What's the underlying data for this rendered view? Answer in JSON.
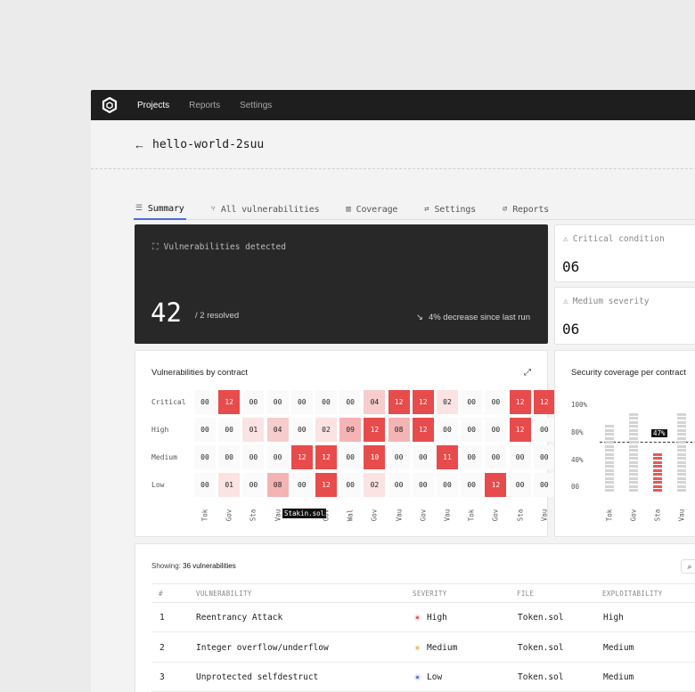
{
  "nav": {
    "items": [
      "Projects",
      "Reports",
      "Settings"
    ],
    "active": 0
  },
  "project": {
    "title": "hello-world-2suu"
  },
  "tabs": [
    {
      "label": "Summary",
      "icon": "sliders-icon"
    },
    {
      "label": "All vulnerabilities",
      "icon": "branch-icon"
    },
    {
      "label": "Coverage",
      "icon": "columns-icon"
    },
    {
      "label": "Settings",
      "icon": "toggle-icon"
    },
    {
      "label": "Reports",
      "icon": "paperclip-icon"
    }
  ],
  "summary": {
    "label": "Vulnerabilities detected",
    "count": "42",
    "resolved": "/ 2 resolved",
    "trend": "4% decrease since last run"
  },
  "critical": {
    "label": "Critical condition",
    "value": "06"
  },
  "medium": {
    "label": "Medium severity",
    "value": "06"
  },
  "heatmap": {
    "title": "Vulnerabilities by contract",
    "rows": [
      "Critical",
      "High",
      "Medium",
      "Low"
    ],
    "columns": [
      "Tok",
      "Gov",
      "Sta",
      "Vau",
      "Stakin.sol",
      "Gov",
      "Wal",
      "Gov",
      "Vau",
      "Gov",
      "Vau",
      "Tok",
      "Gov",
      "Sta",
      "Vau"
    ],
    "highlighted_column_label": "Stakin.sol",
    "values": [
      [
        "00",
        "12",
        "00",
        "00",
        "00",
        "00",
        "00",
        "04",
        "12",
        "12",
        "02",
        "00",
        "00",
        "12",
        "12"
      ],
      [
        "00",
        "00",
        "01",
        "04",
        "00",
        "02",
        "09",
        "12",
        "08",
        "12",
        "00",
        "00",
        "00",
        "12",
        "00"
      ],
      [
        "00",
        "00",
        "00",
        "00",
        "12",
        "12",
        "00",
        "10",
        "00",
        "00",
        "11",
        "00",
        "00",
        "00",
        "00"
      ],
      [
        "00",
        "01",
        "00",
        "08",
        "00",
        "12",
        "00",
        "02",
        "00",
        "00",
        "00",
        "00",
        "12",
        "00",
        "00"
      ]
    ]
  },
  "coverage": {
    "title": "Security coverage per contract",
    "y_labels": [
      "100%",
      "80%",
      "40%",
      "00"
    ],
    "contracts": [
      "Tok",
      "Gov",
      "Sta",
      "Vau"
    ],
    "values": [
      0.78,
      0.88,
      0.47,
      0.88
    ],
    "highlight_index": 2,
    "highlight_label": "47%"
  },
  "table": {
    "showing_prefix": "Showing:",
    "showing_count": "36 vulnerabilities",
    "headers": [
      "#",
      "VULNERABILITY",
      "SEVERITY",
      "FILE",
      "EXPLOITABILITY"
    ],
    "rows": [
      {
        "n": "1",
        "name": "Reentrancy Attack",
        "severity": "High",
        "file": "Token.sol",
        "exploit": "High",
        "color": "#e84b4b"
      },
      {
        "n": "2",
        "name": "Integer overflow/underflow",
        "severity": "Medium",
        "file": "Token.sol",
        "exploit": "Medium",
        "color": "#f0b04a"
      },
      {
        "n": "3",
        "name": "Unprotected selfdestruct",
        "severity": "Low",
        "file": "Token.sol",
        "exploit": "Medium",
        "color": "#4d6bd6"
      }
    ]
  }
}
